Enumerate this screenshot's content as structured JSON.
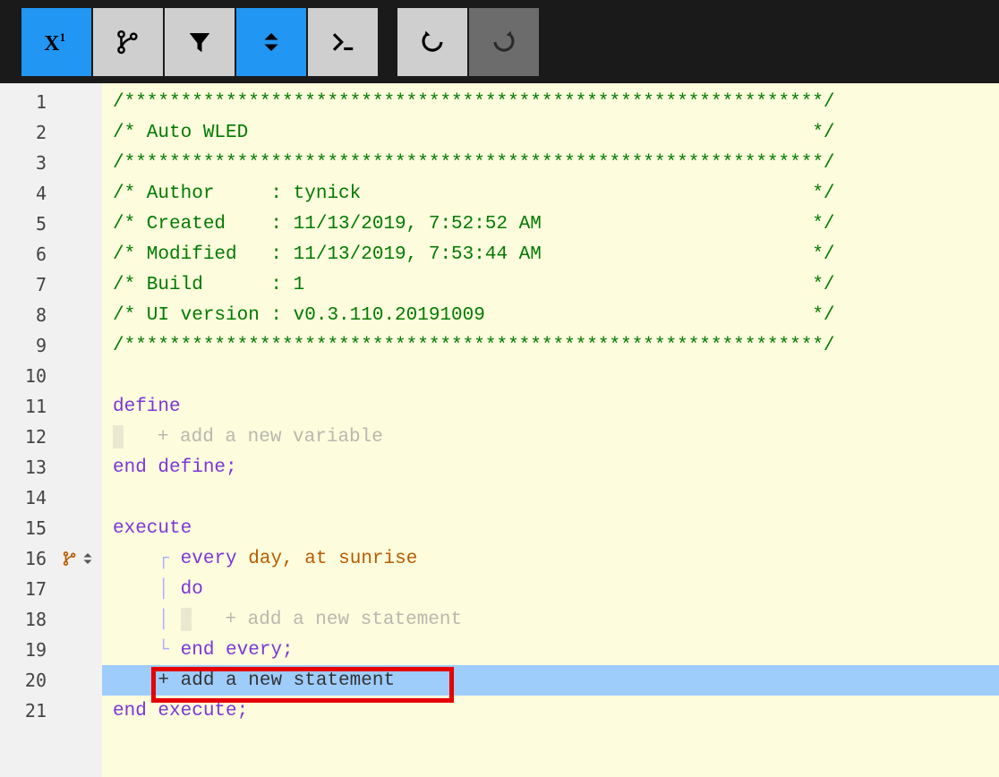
{
  "toolbar": {
    "icons": [
      {
        "name": "expression-icon",
        "svg": "expr",
        "bg": "blue"
      },
      {
        "name": "branch-icon",
        "svg": "branch",
        "bg": "grey"
      },
      {
        "name": "filter-icon",
        "svg": "filter",
        "bg": "grey"
      },
      {
        "name": "sort-icon",
        "svg": "sort",
        "bg": "blue"
      },
      {
        "name": "terminal-icon",
        "svg": "terminal",
        "bg": "grey"
      },
      {
        "name": "undo-icon",
        "svg": "undo",
        "bg": "grey"
      },
      {
        "name": "redo-icon",
        "svg": "redo",
        "bg": "darkgrey"
      }
    ]
  },
  "code": {
    "border": "/**************************************************************/",
    "title": "/* Auto WLED                                                  */",
    "author": "/* Author     : tynick                                        */",
    "created": "/* Created    : 11/13/2019, 7:52:52 AM                        */",
    "modified": "/* Modified   : 11/13/2019, 7:53:44 AM                        */",
    "build": "/* Build      : 1                                             */",
    "uiver": "/* UI version : v0.3.110.20191009                             */",
    "define": "define",
    "end_define": "end define;",
    "execute": "execute",
    "every": "every",
    "day": "day",
    "comma_at": ", at",
    "sunrise": "sunrise",
    "do": "do",
    "end_every": "end every;",
    "end_execute": "end execute;",
    "add_var": "+ add a new variable",
    "add_stmt": "+ add a new statement"
  },
  "line_numbers": [
    "1",
    "2",
    "3",
    "4",
    "5",
    "6",
    "7",
    "8",
    "9",
    "10",
    "11",
    "12",
    "13",
    "14",
    "15",
    "16",
    "17",
    "18",
    "19",
    "20",
    "21"
  ],
  "gutter_marker_line": 16
}
